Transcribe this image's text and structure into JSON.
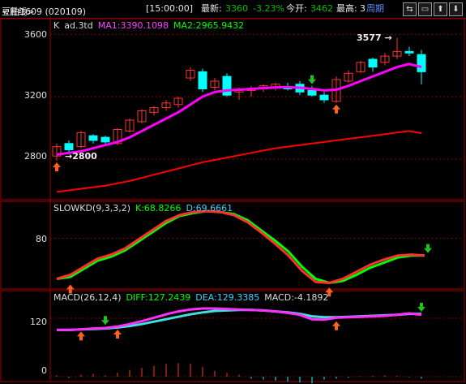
{
  "header": {
    "instrument": "豆粕1609 (020109)",
    "period": "<日线>",
    "time": "[15:00:00]",
    "latest_label": "最新:",
    "latest_value": "3360",
    "change": "-3.23%",
    "open_label": "今开:",
    "open_value": "3462",
    "high_label": "最高:",
    "high_value": "3",
    "period_button": "周期",
    "buttons": [
      "⇆",
      "▭",
      "⬆",
      "⬇"
    ]
  },
  "colors": {
    "up": "#ff3232",
    "down": "#00ffff",
    "ma1": "#ff00ff",
    "ma2": "#ff0000",
    "k": "#ff3030",
    "d": "#ff30ff",
    "diff": "#ff30ff",
    "dea": "#40e0e0",
    "green_line": "#00ff00",
    "grid": "#8b0000"
  },
  "main_panel": {
    "title": "K",
    "indicator": "ad.3td",
    "ma1_text": "MA1:3390.1098",
    "ma2_text": "MA2:2965.9432",
    "y_ticks": [
      "3600",
      "3200",
      "2800"
    ],
    "high_annotation": "3577",
    "low_annotation": "2800"
  },
  "kd_panel": {
    "title": "SLOWKD(9,3,3,2)",
    "k_text": "K:68.8266",
    "d_text": "D:69.6661",
    "y_ticks": [
      "80"
    ]
  },
  "macd_panel": {
    "title": "MACD(26,12,4)",
    "diff_text": "DIFF:127.2439",
    "dea_text": "DEA:129.3385",
    "macd_text": "MACD:-4.1892",
    "y_ticks": [
      "120",
      "0"
    ]
  },
  "chart_data": {
    "type": "candlestick",
    "y_range": [
      2540,
      3700
    ],
    "candles": [
      {
        "o": 2820,
        "h": 2900,
        "l": 2790,
        "c": 2880
      },
      {
        "o": 2900,
        "h": 2920,
        "l": 2840,
        "c": 2860
      },
      {
        "o": 2880,
        "h": 2980,
        "l": 2870,
        "c": 2970
      },
      {
        "o": 2950,
        "h": 2960,
        "l": 2900,
        "c": 2920
      },
      {
        "o": 2940,
        "h": 2950,
        "l": 2890,
        "c": 2910
      },
      {
        "o": 2900,
        "h": 3000,
        "l": 2890,
        "c": 2990
      },
      {
        "o": 2980,
        "h": 3060,
        "l": 2970,
        "c": 3050
      },
      {
        "o": 3040,
        "h": 3120,
        "l": 3030,
        "c": 3110
      },
      {
        "o": 3100,
        "h": 3140,
        "l": 3080,
        "c": 3130
      },
      {
        "o": 3130,
        "h": 3180,
        "l": 3110,
        "c": 3160
      },
      {
        "o": 3150,
        "h": 3200,
        "l": 3130,
        "c": 3190
      },
      {
        "o": 3320,
        "h": 3390,
        "l": 3300,
        "c": 3370
      },
      {
        "o": 3360,
        "h": 3380,
        "l": 3230,
        "c": 3250
      },
      {
        "o": 3260,
        "h": 3320,
        "l": 3240,
        "c": 3300
      },
      {
        "o": 3330,
        "h": 3350,
        "l": 3200,
        "c": 3210
      },
      {
        "o": 3230,
        "h": 3260,
        "l": 3180,
        "c": 3240
      },
      {
        "o": 3240,
        "h": 3270,
        "l": 3200,
        "c": 3250
      },
      {
        "o": 3250,
        "h": 3280,
        "l": 3230,
        "c": 3270
      },
      {
        "o": 3260,
        "h": 3290,
        "l": 3240,
        "c": 3280
      },
      {
        "o": 3260,
        "h": 3290,
        "l": 3240,
        "c": 3250
      },
      {
        "o": 3280,
        "h": 3300,
        "l": 3210,
        "c": 3230
      },
      {
        "o": 3240,
        "h": 3270,
        "l": 3200,
        "c": 3210
      },
      {
        "o": 3210,
        "h": 3230,
        "l": 3160,
        "c": 3180
      },
      {
        "o": 3170,
        "h": 3330,
        "l": 3160,
        "c": 3310
      },
      {
        "o": 3300,
        "h": 3370,
        "l": 3290,
        "c": 3350
      },
      {
        "o": 3360,
        "h": 3430,
        "l": 3350,
        "c": 3420
      },
      {
        "o": 3440,
        "h": 3450,
        "l": 3360,
        "c": 3390
      },
      {
        "o": 3420,
        "h": 3480,
        "l": 3400,
        "c": 3460
      },
      {
        "o": 3460,
        "h": 3577,
        "l": 3440,
        "c": 3490
      },
      {
        "o": 3490,
        "h": 3520,
        "l": 3460,
        "c": 3480
      },
      {
        "o": 3470,
        "h": 3500,
        "l": 3280,
        "c": 3360
      }
    ],
    "ma1": [
      2830,
      2840,
      2850,
      2870,
      2890,
      2910,
      2940,
      2980,
      3020,
      3060,
      3100,
      3150,
      3200,
      3230,
      3240,
      3245,
      3250,
      3255,
      3260,
      3262,
      3258,
      3250,
      3240,
      3245,
      3270,
      3300,
      3330,
      3360,
      3390,
      3410,
      3390
    ],
    "ma2": [
      2590,
      2600,
      2610,
      2620,
      2630,
      2645,
      2660,
      2680,
      2700,
      2720,
      2740,
      2760,
      2780,
      2795,
      2810,
      2825,
      2840,
      2855,
      2870,
      2880,
      2890,
      2900,
      2910,
      2920,
      2930,
      2940,
      2950,
      2960,
      2970,
      2980,
      2966
    ],
    "kd_range": [
      30,
      115
    ],
    "k": [
      40,
      44,
      52,
      60,
      64,
      70,
      79,
      88,
      97,
      103,
      106,
      107,
      106,
      103,
      96,
      86,
      75,
      63,
      48,
      37,
      36,
      40,
      47,
      54,
      59,
      63,
      64,
      63
    ],
    "d": [
      40,
      42,
      50,
      58,
      62,
      68,
      77,
      86,
      95,
      102,
      105,
      107,
      106,
      104,
      98,
      88,
      78,
      67,
      52,
      40,
      36,
      38,
      44,
      51,
      56,
      61,
      63,
      63
    ],
    "macd_range": [
      -10,
      170
    ],
    "diff": [
      96,
      96,
      97,
      99,
      100,
      103,
      108,
      114,
      121,
      128,
      134,
      138,
      140,
      140,
      139,
      138,
      137,
      136,
      134,
      131,
      127,
      118,
      117,
      121,
      122,
      123,
      124,
      125,
      127,
      130,
      127
    ],
    "dea": [
      96,
      96,
      97,
      98,
      99,
      101,
      104,
      108,
      113,
      118,
      123,
      128,
      132,
      135,
      136,
      137,
      137,
      136,
      134,
      132,
      129,
      124,
      122,
      122,
      123,
      124,
      125,
      126,
      127,
      129,
      129
    ],
    "macd_bars": [
      3,
      -2,
      4,
      6,
      3,
      8,
      14,
      18,
      22,
      26,
      28,
      27,
      20,
      12,
      8,
      4,
      -4,
      -6,
      -8,
      -10,
      -12,
      -14,
      -6,
      -4,
      -2,
      1,
      2,
      3,
      2,
      -1,
      -4
    ]
  }
}
